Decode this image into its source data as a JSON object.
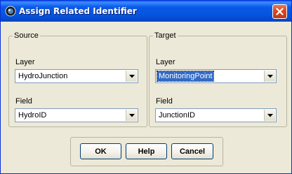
{
  "window": {
    "title": "Assign Related Identifier"
  },
  "source": {
    "legend": "Source",
    "layer_label": "Layer",
    "layer_value": "HydroJunction",
    "field_label": "Field",
    "field_value": "HydroID"
  },
  "target": {
    "legend": "Target",
    "layer_label": "Layer",
    "layer_value": "MonitoringPoint",
    "field_label": "Field",
    "field_value": "JunctionID"
  },
  "buttons": {
    "ok": "OK",
    "help": "Help",
    "cancel": "Cancel"
  },
  "colors": {
    "titlebar": "#0a5ae8",
    "selection": "#316ac5",
    "dialog_bg": "#ece9d8",
    "close_button": "#d9481f"
  },
  "icons": {
    "title": "app-icon",
    "close": "close-icon",
    "dropdown": "chevron-down-icon"
  }
}
